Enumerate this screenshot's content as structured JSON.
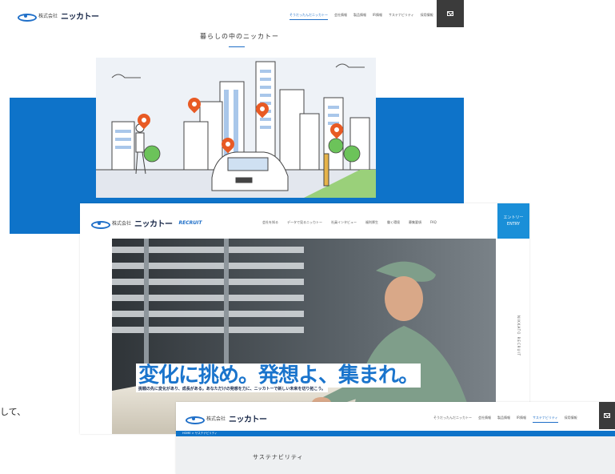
{
  "screenshot1": {
    "logo_small": "株式会社",
    "logo_big": "ニッカトー",
    "nav": [
      "そうだったんだニッカトー",
      "会社情報",
      "製品情報",
      "IR情報",
      "サステナビリティ",
      "採用情報"
    ],
    "nav_active_index": 0,
    "section_title": "暮らしの中のニッカトー"
  },
  "screenshot2": {
    "logo_small": "株式会社",
    "logo_big": "ニッカトー",
    "recruit_label": "RECRUIT",
    "nav": [
      "会社を知る",
      "データで見るニッカトー",
      "社員インタビュー",
      "福利厚生",
      "働く環境",
      "募集要項",
      "FAQ"
    ],
    "entry_jp": "エントリー",
    "entry_en": "ENTRY",
    "catchphrase": "変化に挑め。発想よ、集まれ。",
    "subtext": "挑戦の先に変化があり、成長がある。あなただけの発想を力に、ニッカトーで新しい未来を切り拓こう。",
    "side_label": "NIKKATO RECRUIT"
  },
  "screenshot3": {
    "logo_small": "株式会社",
    "logo_big": "ニッカトー",
    "nav": [
      "そうだったんだニッカトー",
      "会社情報",
      "製品情報",
      "IR情報",
      "サステナビリティ",
      "採用情報"
    ],
    "nav_active_index": 4,
    "breadcrumb": "HOME > サステナビリティ",
    "page_title": "サステナビリティ"
  },
  "left_fragment": "して、",
  "colors": {
    "brand_blue": "#0e73c9",
    "accent_orange": "#e85a24",
    "dark_button": "#3b3b3b",
    "entry_blue": "#1a8fd8"
  }
}
